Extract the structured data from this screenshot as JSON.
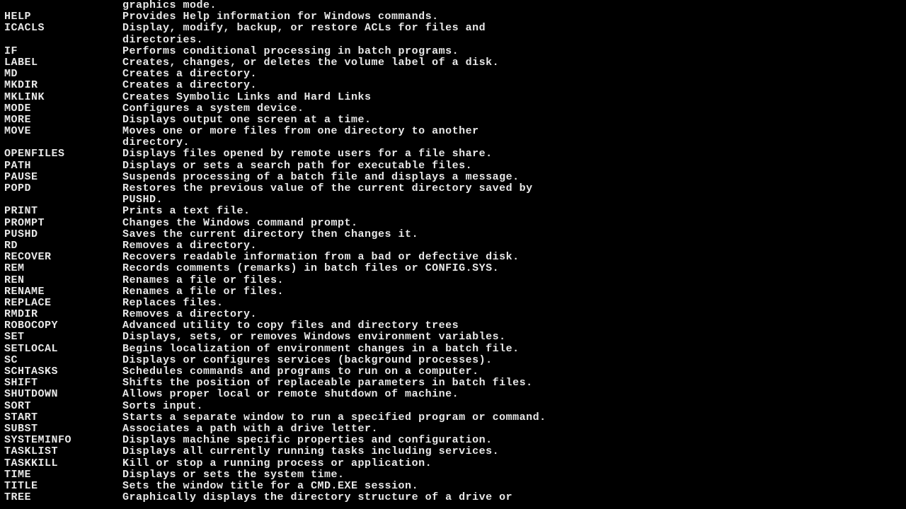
{
  "lines": [
    {
      "cmd": "",
      "desc": "graphics mode."
    },
    {
      "cmd": "HELP",
      "desc": "Provides Help information for Windows commands."
    },
    {
      "cmd": "ICACLS",
      "desc": "Display, modify, backup, or restore ACLs for files and"
    },
    {
      "cmd": "",
      "desc": "directories."
    },
    {
      "cmd": "IF",
      "desc": "Performs conditional processing in batch programs."
    },
    {
      "cmd": "LABEL",
      "desc": "Creates, changes, or deletes the volume label of a disk."
    },
    {
      "cmd": "MD",
      "desc": "Creates a directory."
    },
    {
      "cmd": "MKDIR",
      "desc": "Creates a directory."
    },
    {
      "cmd": "MKLINK",
      "desc": "Creates Symbolic Links and Hard Links"
    },
    {
      "cmd": "MODE",
      "desc": "Configures a system device."
    },
    {
      "cmd": "MORE",
      "desc": "Displays output one screen at a time."
    },
    {
      "cmd": "MOVE",
      "desc": "Moves one or more files from one directory to another"
    },
    {
      "cmd": "",
      "desc": "directory."
    },
    {
      "cmd": "OPENFILES",
      "desc": "Displays files opened by remote users for a file share."
    },
    {
      "cmd": "PATH",
      "desc": "Displays or sets a search path for executable files."
    },
    {
      "cmd": "PAUSE",
      "desc": "Suspends processing of a batch file and displays a message."
    },
    {
      "cmd": "POPD",
      "desc": "Restores the previous value of the current directory saved by"
    },
    {
      "cmd": "",
      "desc": "PUSHD."
    },
    {
      "cmd": "PRINT",
      "desc": "Prints a text file."
    },
    {
      "cmd": "PROMPT",
      "desc": "Changes the Windows command prompt."
    },
    {
      "cmd": "PUSHD",
      "desc": "Saves the current directory then changes it."
    },
    {
      "cmd": "RD",
      "desc": "Removes a directory."
    },
    {
      "cmd": "RECOVER",
      "desc": "Recovers readable information from a bad or defective disk."
    },
    {
      "cmd": "REM",
      "desc": "Records comments (remarks) in batch files or CONFIG.SYS."
    },
    {
      "cmd": "REN",
      "desc": "Renames a file or files."
    },
    {
      "cmd": "RENAME",
      "desc": "Renames a file or files."
    },
    {
      "cmd": "REPLACE",
      "desc": "Replaces files."
    },
    {
      "cmd": "RMDIR",
      "desc": "Removes a directory."
    },
    {
      "cmd": "ROBOCOPY",
      "desc": "Advanced utility to copy files and directory trees"
    },
    {
      "cmd": "SET",
      "desc": "Displays, sets, or removes Windows environment variables."
    },
    {
      "cmd": "SETLOCAL",
      "desc": "Begins localization of environment changes in a batch file."
    },
    {
      "cmd": "SC",
      "desc": "Displays or configures services (background processes)."
    },
    {
      "cmd": "SCHTASKS",
      "desc": "Schedules commands and programs to run on a computer."
    },
    {
      "cmd": "SHIFT",
      "desc": "Shifts the position of replaceable parameters in batch files."
    },
    {
      "cmd": "SHUTDOWN",
      "desc": "Allows proper local or remote shutdown of machine."
    },
    {
      "cmd": "SORT",
      "desc": "Sorts input."
    },
    {
      "cmd": "START",
      "desc": "Starts a separate window to run a specified program or command."
    },
    {
      "cmd": "SUBST",
      "desc": "Associates a path with a drive letter."
    },
    {
      "cmd": "SYSTEMINFO",
      "desc": "Displays machine specific properties and configuration."
    },
    {
      "cmd": "TASKLIST",
      "desc": "Displays all currently running tasks including services."
    },
    {
      "cmd": "TASKKILL",
      "desc": "Kill or stop a running process or application."
    },
    {
      "cmd": "TIME",
      "desc": "Displays or sets the system time."
    },
    {
      "cmd": "TITLE",
      "desc": "Sets the window title for a CMD.EXE session."
    },
    {
      "cmd": "TREE",
      "desc": "Graphically displays the directory structure of a drive or"
    }
  ]
}
